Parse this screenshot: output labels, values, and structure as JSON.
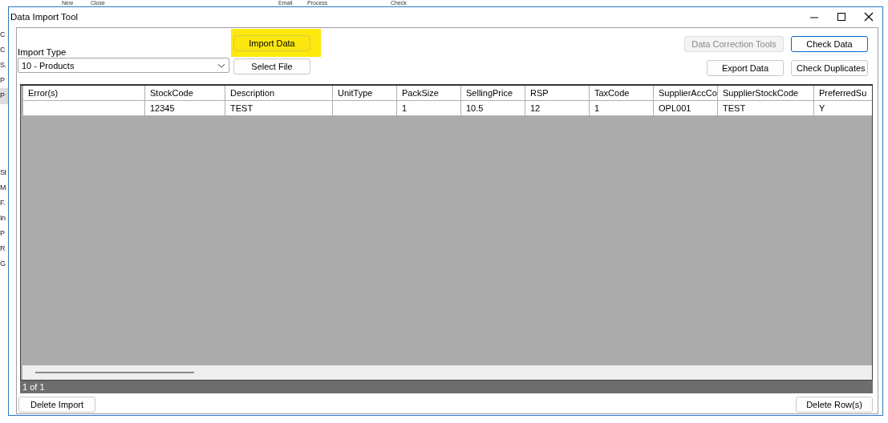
{
  "background_app": {
    "toolbar_texts": [
      "New",
      "Close",
      "Email",
      "Process",
      "Check"
    ],
    "side_letters": [
      "C",
      "C",
      "S.",
      "P",
      "P",
      "St",
      "M",
      "F.",
      "In",
      "P",
      "R",
      "G"
    ]
  },
  "window": {
    "title": "Data Import Tool"
  },
  "import_type": {
    "label": "Import Type",
    "value": "10 - Products"
  },
  "buttons": [
    {
      "label": "Import Data",
      "kind": "import",
      "disabled": false,
      "highlighted": true,
      "focused": false
    },
    {
      "label": "Data Correction Tools",
      "kind": "tools",
      "disabled": true,
      "highlighted": false,
      "focused": false
    },
    {
      "label": "Check Data",
      "kind": "check",
      "disabled": false,
      "highlighted": false,
      "focused": true
    },
    {
      "label": "Select File",
      "kind": "select",
      "disabled": false,
      "highlighted": false,
      "focused": false
    },
    {
      "label": "Export Data",
      "kind": "export",
      "disabled": false,
      "highlighted": false,
      "focused": false
    },
    {
      "label": "Check Duplicates",
      "kind": "duplicates",
      "disabled": false,
      "highlighted": false,
      "focused": false
    }
  ],
  "table": {
    "columns": [
      "Error(s)",
      "StockCode",
      "Description",
      "UnitType",
      "PackSize",
      "SellingPrice",
      "RSP",
      "TaxCode",
      "SupplierAccCo",
      "SupplierStockCode",
      "PreferredSu"
    ],
    "rows": [
      [
        "",
        "12345",
        "TEST",
        "",
        "1",
        "10.5",
        "12",
        "1",
        "OPL001",
        "TEST",
        "Y"
      ]
    ]
  },
  "status_bar": "1 of 1",
  "footer_buttons": [
    "Delete Import",
    "Delete Row(s)"
  ]
}
